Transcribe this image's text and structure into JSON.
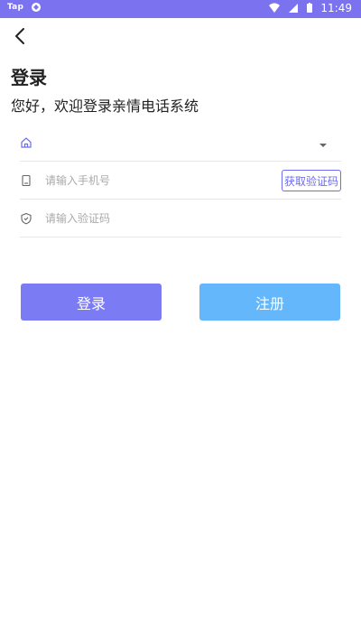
{
  "status_bar": {
    "app_label": "Tap",
    "time": "11:49",
    "bg_color": "#7b72f0"
  },
  "header": {
    "back_icon": "chevron-left-icon"
  },
  "page": {
    "title": "登录",
    "subtitle": "您好，欢迎登录亲情电话系统"
  },
  "form": {
    "org_field": {
      "icon": "home-icon",
      "value": ""
    },
    "phone_field": {
      "icon": "phone-icon",
      "placeholder": "请输入手机号"
    },
    "get_code_button": "获取验证码",
    "code_field": {
      "icon": "shield-icon",
      "placeholder": "请输入验证码"
    }
  },
  "actions": {
    "login_label": "登录",
    "register_label": "注册",
    "login_color": "#7b7bf4",
    "register_color": "#64b7fb"
  }
}
